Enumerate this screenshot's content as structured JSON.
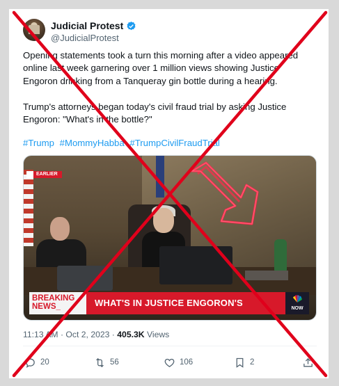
{
  "tweet": {
    "display_name": "Judicial Protest",
    "handle": "@JudicialProtest",
    "text": "Opening statements took a turn this morning after a video appeared online last week garnering over 1 million views showing Justice Engoron drinking from a Tanqueray gin bottle during a hearing.\n\nTrump's attorneys began today's civil fraud trial by asking Justice Engoron:  \"What's in the bottle?\"",
    "hashtags": [
      "#Trump",
      "#MommyHabba",
      "#TrumpCivilFraudTrial"
    ]
  },
  "media": {
    "tag": "EARLIER",
    "breaking": "BREAKING\nNEWS_",
    "headline": "WHAT'S IN JUSTICE ENGORON'S BOTTLE?",
    "logo_text": "NOW"
  },
  "meta": {
    "time_date": "11:13 AM · Oct 2, 2023 · ",
    "views_count": "405.3K",
    "views_label": " Views"
  },
  "actions": {
    "replies": "20",
    "reposts": "56",
    "likes": "106",
    "bookmarks": "2"
  },
  "colors": {
    "accent": "#1d9bf0",
    "overlay_x": "#e0001b",
    "breaking_red": "#d7192a",
    "neon": "#ff2a4a"
  },
  "icons": [
    "verified-icon",
    "reply-icon",
    "repost-icon",
    "like-icon",
    "bookmark-icon",
    "share-icon",
    "nbc-peacock-icon",
    "neon-arrow-icon"
  ]
}
